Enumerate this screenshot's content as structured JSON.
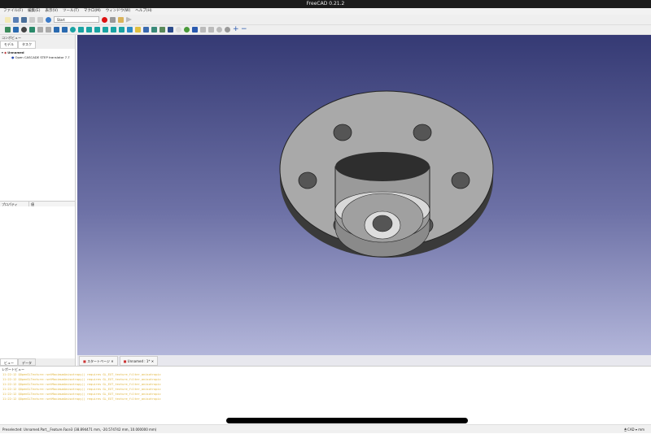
{
  "window": {
    "title": "FreeCAD 0.21.2"
  },
  "menu": [
    "ファイル(F)",
    "編集(E)",
    "表示(V)",
    "ツール(T)",
    "マクロ(M)",
    "ウィンドウ(W)",
    "ヘルプ(H)"
  ],
  "toolbar": {
    "workbench": "Start"
  },
  "combo": {
    "title": "コンボビュー",
    "tabs": [
      "モデル",
      "タスク"
    ],
    "tree": [
      "Unnamed",
      "Open CASCADE STEP translator 7.7"
    ]
  },
  "properties": {
    "headers": [
      "プロパティ",
      "値"
    ],
    "tabs": [
      "ビュー",
      "データ"
    ]
  },
  "doc_tabs": [
    "スタートページ",
    "Unnamed : 1*"
  ],
  "report": {
    "title": "レポートビュー",
    "lines": [
      "11:22:12  QOpenGLTexture::setMaximumAnisotropy() requires GL_EXT_texture_filter_anisotropic",
      "11:22:12  QOpenGLTexture::setMaximumAnisotropy() requires GL_EXT_texture_filter_anisotropic",
      "11:22:12  QOpenGLTexture::setMaximumAnisotropy() requires GL_EXT_texture_filter_anisotropic",
      "11:22:12  QOpenGLTexture::setMaximumAnisotropy() requires GL_EXT_texture_filter_anisotropic",
      "11:22:12  QOpenGLTexture::setMaximumAnisotropy() requires GL_EXT_texture_filter_anisotropic",
      "11:22:12  QOpenGLTexture::setMaximumAnisotropy() requires GL_EXT_texture_filter_anisotropic"
    ]
  },
  "status": {
    "text": "Preselected: Unnamed.Part__Feature.Face3 (38.894471 mm, -20.574742 mm, 10.000000 mm)",
    "nav": "CAD",
    "units": "mm"
  }
}
